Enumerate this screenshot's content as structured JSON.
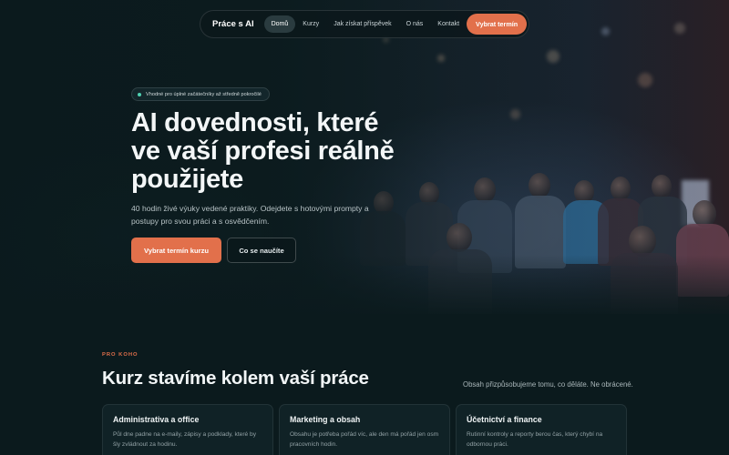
{
  "nav": {
    "brand": "Práce s AI",
    "links": [
      {
        "label": "Domů",
        "active": true
      },
      {
        "label": "Kurzy",
        "active": false
      },
      {
        "label": "Jak získat příspěvek",
        "active": false
      },
      {
        "label": "O nás",
        "active": false
      },
      {
        "label": "Kontakt",
        "active": false
      }
    ],
    "cta": "Vybrat termín"
  },
  "hero": {
    "badge": "Vhodné pro úplné začátečníky až středně pokročilé",
    "title": "AI dovednosti, které ve vaší profesi reálně použijete",
    "subtitle": "40 hodin živé výuky vedené praktiky. Odejdete s hotovými prompty a postupy pro svou práci a s osvědčením.",
    "primary_button": "Vybrat termín kurzu",
    "secondary_button": "Co se naučíte"
  },
  "section": {
    "eyebrow": "PRO KOHO",
    "title": "Kurz stavíme kolem vaší práce",
    "note": "Obsah přizpůsobujeme tomu, co děláte. Ne obrácené.",
    "cards": [
      {
        "title": "Administrativa a office",
        "text": "Půl dne padne na e-maily, zápisy a podklady, které by šly zvládnout za hodinu."
      },
      {
        "title": "Marketing a obsah",
        "text": "Obsahu je potřeba pořád víc, ale den má pořád jen osm pracovních hodin."
      },
      {
        "title": "Účetnictví a finance",
        "text": "Rutinní kontroly a reporty berou čas, který chybí na odbornou práci."
      }
    ]
  },
  "colors": {
    "accent": "#e2704b",
    "background": "#0b1a1d",
    "badge_dot": "#4fd1b2"
  }
}
